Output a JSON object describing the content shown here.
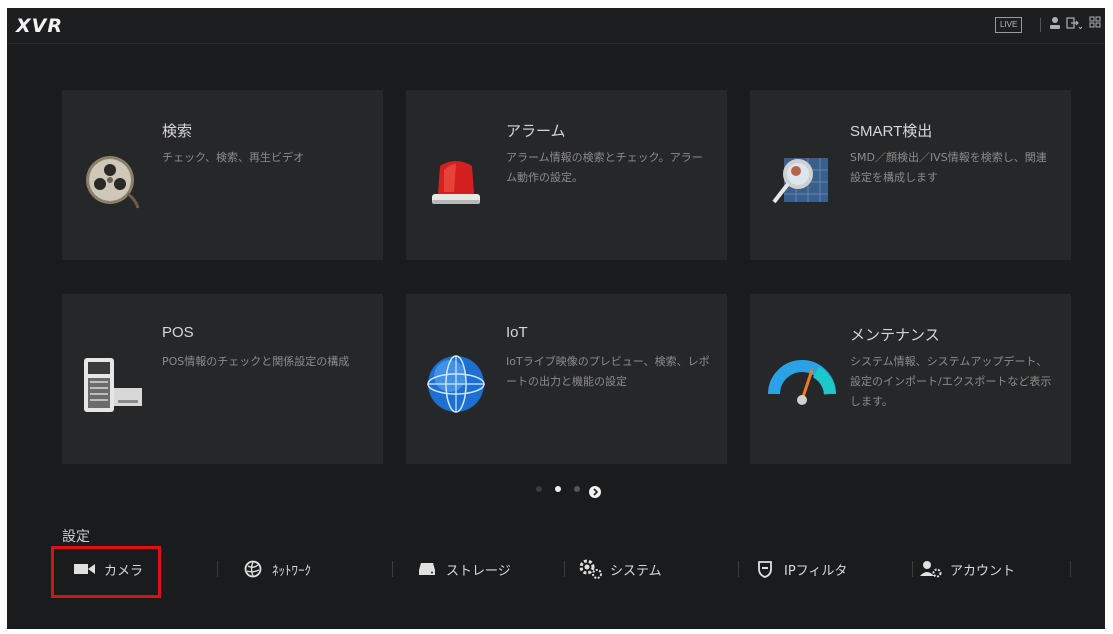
{
  "header": {
    "logo": "XVR",
    "live_label": "LIVE",
    "icons": [
      "user-icon",
      "logout-icon",
      "grid-icon"
    ]
  },
  "cards": [
    {
      "title": "検索",
      "desc": "チェック、検索、再生ビデオ",
      "icon": "film-reel-icon"
    },
    {
      "title": "アラーム",
      "desc": "アラーム情報の検索とチェック。アラーム動作の設定。",
      "icon": "alarm-light-icon"
    },
    {
      "title": "SMART検出",
      "desc": "SMD／顔検出／IVS情報を検索し、関連設定を構成します",
      "icon": "magnifier-icon"
    },
    {
      "title": "POS",
      "desc": "POS情報のチェックと関係設定の構成",
      "icon": "pos-terminal-icon"
    },
    {
      "title": "IoT",
      "desc": "IoTライブ映像のプレビュー、検索、レポートの出力と機能の設定",
      "icon": "globe-icon"
    },
    {
      "title": "メンテナンス",
      "desc": "システム情報、システムアップデート、設定のインポート/エクスポートなど表示します。",
      "icon": "gauge-icon"
    }
  ],
  "pager": {
    "pages": 3,
    "current": 2,
    "next_icon": "next-page-icon"
  },
  "settings": {
    "title": "設定",
    "items": [
      {
        "label": "カメラ",
        "icon": "camera-icon"
      },
      {
        "label": "ﾈｯﾄﾜｰｸ",
        "icon": "network-icon"
      },
      {
        "label": "ストレージ",
        "icon": "storage-icon"
      },
      {
        "label": "システム",
        "icon": "gears-icon"
      },
      {
        "label": "IPフィルタ",
        "icon": "shield-icon"
      },
      {
        "label": "アカウント",
        "icon": "account-icon"
      }
    ]
  },
  "colors": {
    "background": "#1a1b1c",
    "card": "#262729",
    "highlight": "#e01010"
  }
}
